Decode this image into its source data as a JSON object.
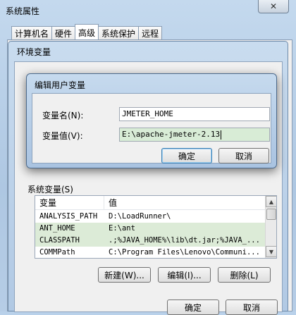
{
  "system_properties": {
    "title": "系统属性",
    "close_glyph": "✕",
    "tabs": [
      {
        "label": "计算机名"
      },
      {
        "label": "硬件"
      },
      {
        "label": "高级"
      },
      {
        "label": "系统保护"
      },
      {
        "label": "远程"
      }
    ]
  },
  "env_vars": {
    "title": "环境变量",
    "system_section_label": "系统变量(S)",
    "columns": [
      "变量",
      "值"
    ],
    "rows": [
      {
        "name": "ANALYSIS_PATH",
        "value": "D:\\LoadRunner\\"
      },
      {
        "name": "ANT_HOME",
        "value": "E:\\ant"
      },
      {
        "name": "CLASSPATH",
        "value": ".;%JAVA_HOME%\\lib\\dt.jar;%JAVA_..."
      },
      {
        "name": "COMMPath",
        "value": "C:\\Program Files\\Lenovo\\Communi..."
      }
    ],
    "new_label": "新建(W)...",
    "edit_label": "编辑(I)...",
    "delete_label": "删除(L)",
    "ok_label": "确定",
    "cancel_label": "取消"
  },
  "edit_dialog": {
    "title": "编辑用户变量",
    "name_label": "变量名(N):",
    "name_value": "JMETER_HOME",
    "value_label": "变量值(V):",
    "value_value": "E:\\apache-jmeter-2.13",
    "ok_label": "确定",
    "cancel_label": "取消"
  }
}
